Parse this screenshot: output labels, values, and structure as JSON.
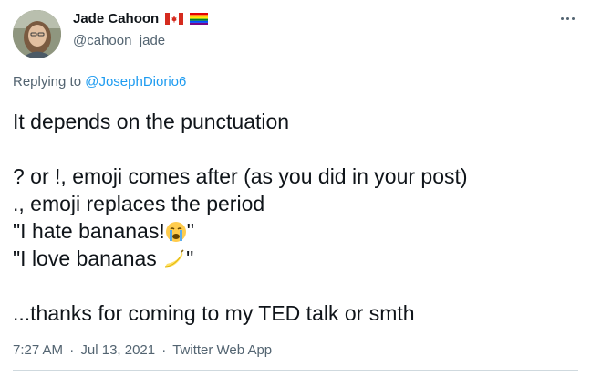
{
  "author": {
    "display_name": "Jade Cahoon",
    "handle": "@cahoon_jade",
    "flags": [
      "canada-flag-icon",
      "rainbow-flag-icon"
    ]
  },
  "reply": {
    "prefix": "Replying to",
    "mention": "@JosephDiorio6"
  },
  "tweet_lines": [
    "It depends on the punctuation",
    "",
    "? or !, emoji comes after (as you did in your post)",
    "., emoji replaces the period"
  ],
  "example_hate": {
    "before": "\"I hate bananas!",
    "emoji": "crying-face-icon",
    "after": "\""
  },
  "example_love": {
    "before": "\"I love bananas ",
    "emoji": "banana-icon",
    "after": "\""
  },
  "closing": "...thanks for coming to my TED talk or smth",
  "meta": {
    "time": "7:27 AM",
    "date": "Jul 13, 2021",
    "source": "Twitter Web App",
    "separator": "·"
  },
  "colors": {
    "text": "#0f1419",
    "secondary": "#536471",
    "link": "#1d9bf0",
    "divider": "#cfd9de"
  }
}
